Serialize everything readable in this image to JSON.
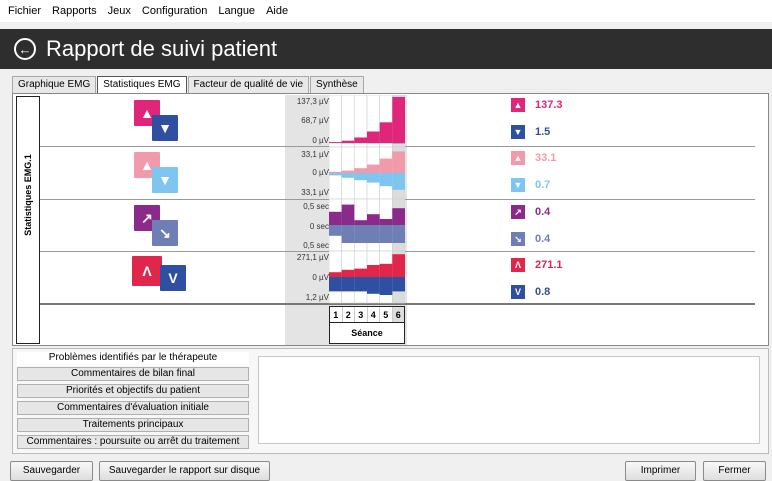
{
  "menu": [
    "Fichier",
    "Rapports",
    "Jeux",
    "Configuration",
    "Langue",
    "Aide"
  ],
  "header": {
    "title": "Rapport de suivi patient",
    "back_icon": "back-arrow-icon"
  },
  "tabs": [
    {
      "label": "Graphique EMG",
      "active": false
    },
    {
      "label": "Statistiques EMG",
      "active": true
    },
    {
      "label": "Facteur de qualité de vie",
      "active": false
    },
    {
      "label": "Synthèse",
      "active": false
    }
  ],
  "side_label": "Statistiques EMG.1",
  "rows": [
    {
      "axis": [
        "137,3 µV",
        "68,7 µV",
        "0 µV"
      ],
      "legend": [
        {
          "value": "137.3",
          "color": "#e0267a",
          "icon": "triangle-up-icon"
        },
        {
          "value": "1.5",
          "color": "#2f4fa3",
          "icon": "triangle-down-icon"
        }
      ],
      "series_top": [
        0.02,
        0.05,
        0.12,
        0.25,
        0.45,
        1.0
      ],
      "series_bottom": [
        0.03,
        0.05,
        0.04,
        0.06,
        0.05,
        0.08
      ]
    },
    {
      "axis": [
        "33,1 µV",
        "0 µV",
        "33,1 µV"
      ],
      "legend": [
        {
          "value": "33.1",
          "color": "#f19aac",
          "icon": "warning-triangle-icon"
        },
        {
          "value": "0.7",
          "color": "#7ec6ef",
          "icon": "triangle-down-icon"
        }
      ],
      "series_top": [
        0.05,
        0.1,
        0.2,
        0.35,
        0.6,
        0.9
      ],
      "series_bottom": [
        0.1,
        0.2,
        0.3,
        0.4,
        0.55,
        0.7
      ]
    },
    {
      "axis": [
        "0,5 sec",
        "0 sec",
        "0,5 sec"
      ],
      "legend": [
        {
          "value": "0.4",
          "color": "#8c2a8c",
          "icon": "ramp-up-icon"
        },
        {
          "value": "0.4",
          "color": "#6f7fb5",
          "icon": "ramp-down-icon"
        }
      ],
      "series_top": [
        0.55,
        0.85,
        0.2,
        0.45,
        0.25,
        0.7
      ],
      "series_bottom": [
        0.45,
        0.75,
        0.75,
        0.75,
        0.75,
        0.75
      ]
    },
    {
      "axis": [
        "271,1 µV",
        "0 µV",
        "1,2 µV"
      ],
      "legend": [
        {
          "value": "271.1",
          "color": "#e0264a",
          "icon": "peak-icon"
        },
        {
          "value": "0.8",
          "color": "#2f4fa3",
          "icon": "valley-icon"
        }
      ],
      "series_top": [
        0.2,
        0.3,
        0.35,
        0.5,
        0.55,
        0.95
      ],
      "series_bottom": [
        0.6,
        0.6,
        0.6,
        0.7,
        0.75,
        0.6
      ]
    }
  ],
  "seance": {
    "sessions": [
      "1",
      "2",
      "3",
      "4",
      "5",
      "6"
    ],
    "label": "Séance"
  },
  "notes": {
    "items": [
      "Problèmes identifiés par le thérapeute",
      "Commentaires de bilan final",
      "Priorités et objectifs du patient",
      "Commentaires d'évaluation initiale",
      "Traitements principaux",
      "Commentaires : poursuite ou arrêt du traitement"
    ],
    "active_index": 0
  },
  "buttons": {
    "save": "Sauvegarder",
    "save_disk": "Sauvegarder le rapport sur disque",
    "print": "Imprimer",
    "close": "Fermer"
  }
}
